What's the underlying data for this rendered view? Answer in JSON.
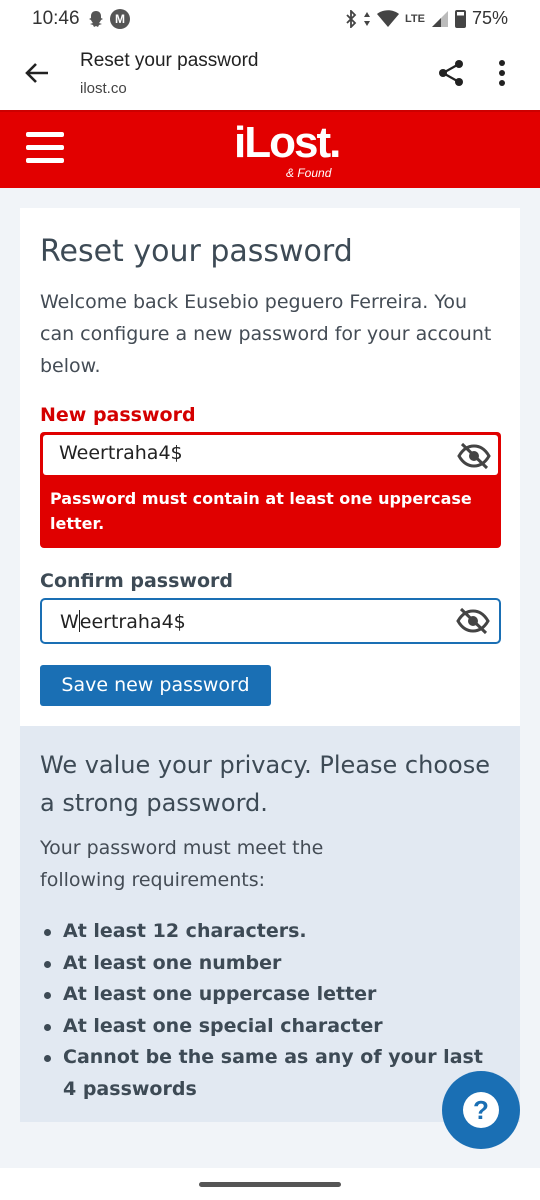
{
  "status_bar": {
    "time": "10:46",
    "network": "LTE",
    "battery": "75%",
    "battery_level": 0.75
  },
  "browser": {
    "page_title": "Reset your password",
    "url": "ilost.co",
    "icons": [
      "back-arrow-icon",
      "share-icon",
      "more-vert-icon"
    ]
  },
  "site_header": {
    "brand": "iLost.",
    "tagline": "& Found",
    "background_color": "#e20000"
  },
  "form": {
    "heading": "Reset your password",
    "intro": "Welcome back Eusebio peguero Ferreira. You can configure a new password for your account below.",
    "new_password_label": "New password",
    "new_password_value": "Weertraha4$",
    "error_message": "Password must contain at least one uppercase letter.",
    "confirm_password_label": "Confirm password",
    "confirm_password_value_first": "W",
    "confirm_password_value_rest": "eertraha4$",
    "save_button": "Save new password",
    "accent_color": "#1a6fb4",
    "error_color": "#e00000"
  },
  "privacy": {
    "heading": "We value your privacy. Please choose a strong password.",
    "requirements_intro": "Your password must meet the following requirements:",
    "requirements": [
      "At least 12 characters.",
      "At least one number",
      "At least one uppercase letter",
      "At least one special character",
      "Cannot be the same as any of your last 4 passwords"
    ]
  },
  "help": {
    "label": "?"
  }
}
